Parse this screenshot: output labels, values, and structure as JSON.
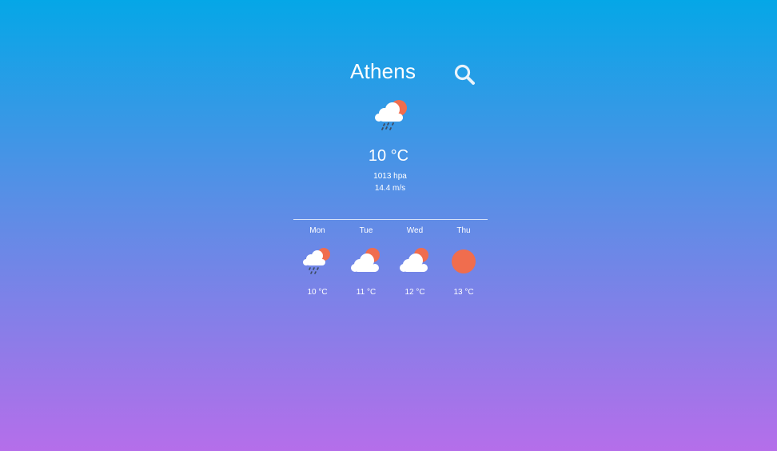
{
  "current": {
    "city": "Athens",
    "icon": "cloud-sun-rain-icon",
    "temperature": "10 °C",
    "pressure": "1013 hpa",
    "wind": "14.4 m/s"
  },
  "search": {
    "icon": "search-icon"
  },
  "forecast": [
    {
      "day": "Mon",
      "icon": "cloud-sun-rain-icon",
      "temp": "10 °C"
    },
    {
      "day": "Tue",
      "icon": "cloud-sun-icon",
      "temp": "11 °C"
    },
    {
      "day": "Wed",
      "icon": "cloud-sun-icon",
      "temp": "12 °C"
    },
    {
      "day": "Thu",
      "icon": "sun-icon",
      "temp": "13 °C"
    }
  ],
  "colors": {
    "gradient_top": "#05a7e7",
    "gradient_bottom": "#b56eea",
    "sun": "#f06d4e",
    "cloud": "#ffffff",
    "rain": "#3d4b63"
  }
}
